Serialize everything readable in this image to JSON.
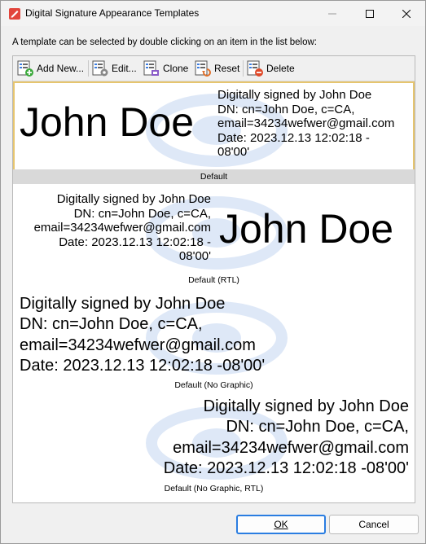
{
  "window": {
    "title": "Digital Signature Appearance Templates",
    "icons": {
      "app": "pdf-app-icon",
      "minimize": "minimize-icon",
      "maximize": "maximize-icon",
      "close": "close-icon"
    }
  },
  "instruction": "A template can be selected by double clicking on an item in the list below:",
  "toolbar": {
    "add_new": "Add New...",
    "edit": "Edit...",
    "clone": "Clone",
    "reset": "Reset",
    "delete": "Delete"
  },
  "templates": [
    {
      "caption": "Default",
      "selected": true,
      "name": "John Doe",
      "lines": [
        "Digitally signed by John Doe",
        "DN: cn=John Doe, c=CA,",
        "email=34234wefwer@gmail.com",
        "Date: 2023.12.13 12:02:18 -",
        "08'00'"
      ]
    },
    {
      "caption": "Default (RTL)",
      "name": "John Doe",
      "lines": [
        "Digitally signed by John Doe",
        "DN: cn=John Doe, c=CA,",
        "email=34234wefwer@gmail.com",
        "Date: 2023.12.13 12:02:18 -",
        "08'00'"
      ]
    },
    {
      "caption": "Default (No Graphic)",
      "lines": [
        "Digitally signed by John Doe",
        "DN: cn=John Doe, c=CA,",
        "email=34234wefwer@gmail.com",
        "Date: 2023.12.13 12:02:18 -08'00'"
      ]
    },
    {
      "caption": "Default (No Graphic, RTL)",
      "lines": [
        "Digitally signed by John Doe",
        "DN: cn=John Doe, c=CA,",
        "email=34234wefwer@gmail.com",
        "Date: 2023.12.13 12:02:18 -08'00'"
      ]
    }
  ],
  "buttons": {
    "ok": "OK",
    "cancel": "Cancel"
  },
  "colors": {
    "accent": "#2a7de1",
    "selection_border": "#e6c56e",
    "watermark": "#2f6fd0"
  }
}
